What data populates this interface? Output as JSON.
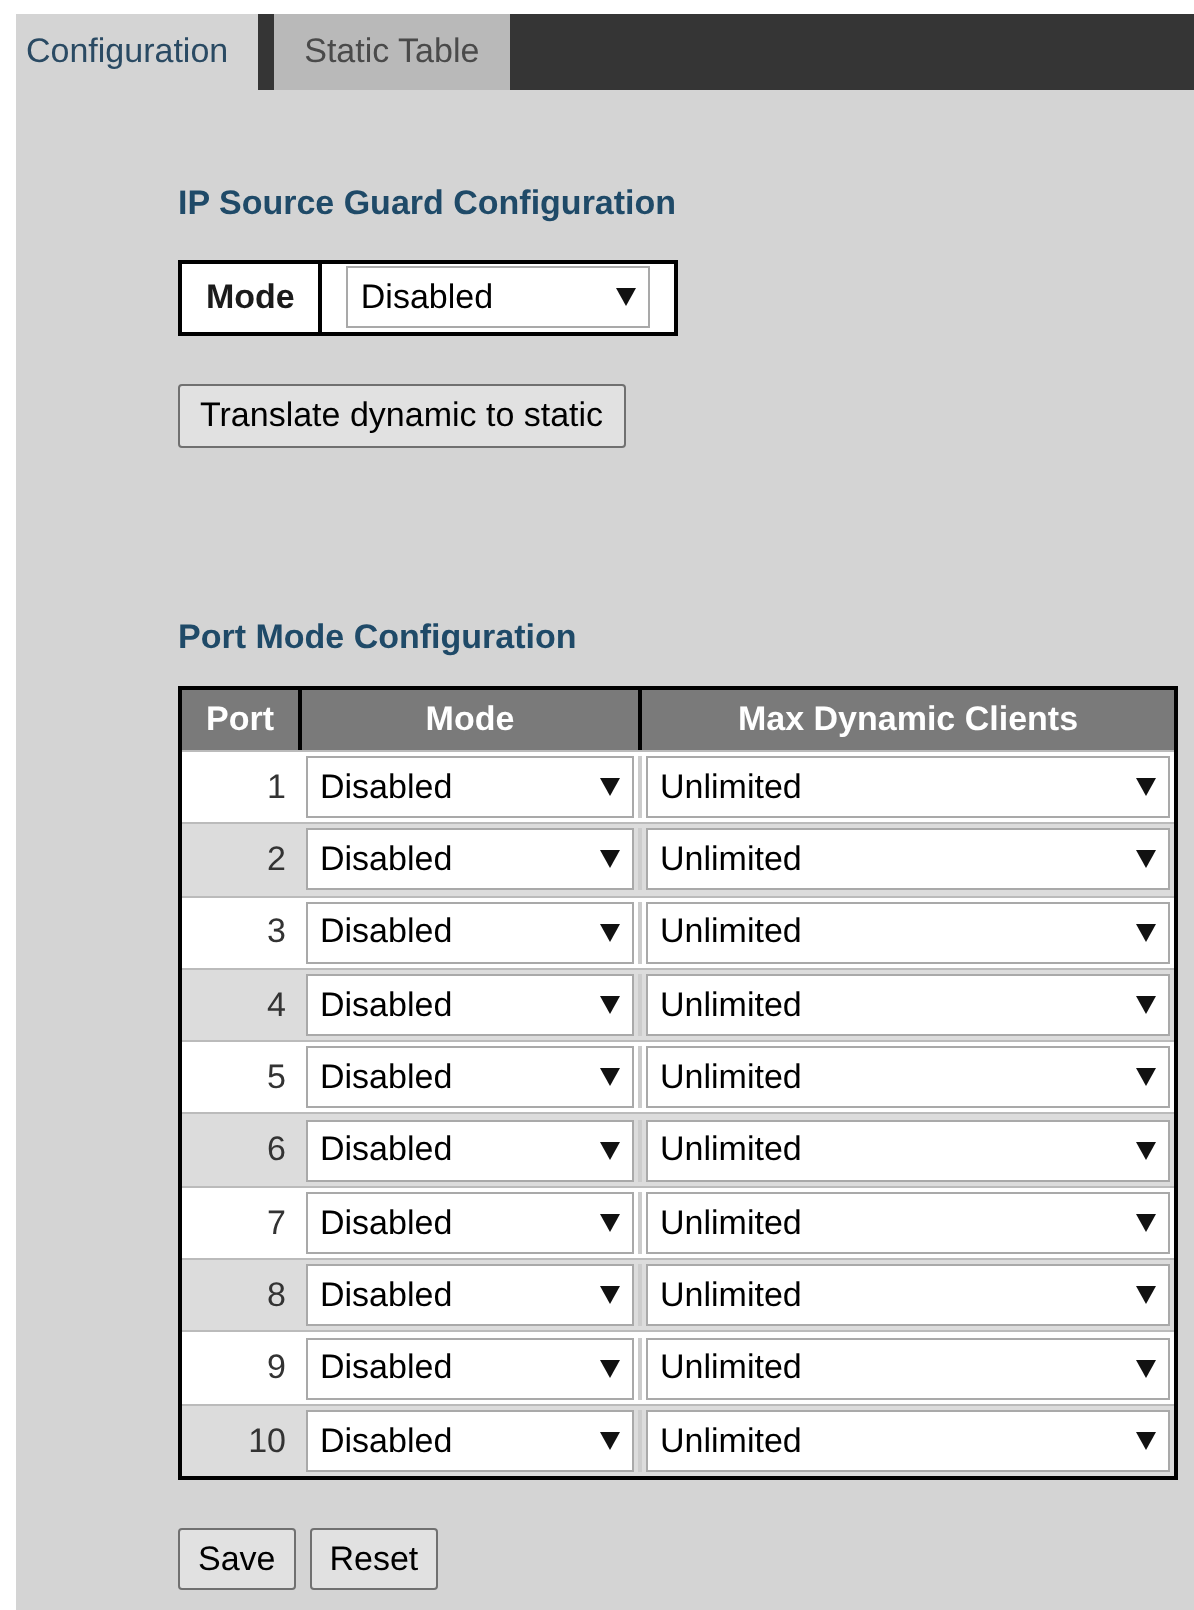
{
  "tabs": [
    {
      "label": "Configuration",
      "selected": true
    },
    {
      "label": "Static Table",
      "selected": false
    }
  ],
  "guard": {
    "title": "IP Source Guard Configuration",
    "mode_label": "Mode",
    "mode_value": "Disabled",
    "translate_button": "Translate dynamic to static"
  },
  "port_table": {
    "title": "Port Mode Configuration",
    "columns": [
      "Port",
      "Mode",
      "Max Dynamic Clients"
    ],
    "rows": [
      {
        "port": "1",
        "mode": "Disabled",
        "max_clients": "Unlimited"
      },
      {
        "port": "2",
        "mode": "Disabled",
        "max_clients": "Unlimited"
      },
      {
        "port": "3",
        "mode": "Disabled",
        "max_clients": "Unlimited"
      },
      {
        "port": "4",
        "mode": "Disabled",
        "max_clients": "Unlimited"
      },
      {
        "port": "5",
        "mode": "Disabled",
        "max_clients": "Unlimited"
      },
      {
        "port": "6",
        "mode": "Disabled",
        "max_clients": "Unlimited"
      },
      {
        "port": "7",
        "mode": "Disabled",
        "max_clients": "Unlimited"
      },
      {
        "port": "8",
        "mode": "Disabled",
        "max_clients": "Unlimited"
      },
      {
        "port": "9",
        "mode": "Disabled",
        "max_clients": "Unlimited"
      },
      {
        "port": "10",
        "mode": "Disabled",
        "max_clients": "Unlimited"
      }
    ]
  },
  "buttons": [
    "Save",
    "Reset"
  ]
}
